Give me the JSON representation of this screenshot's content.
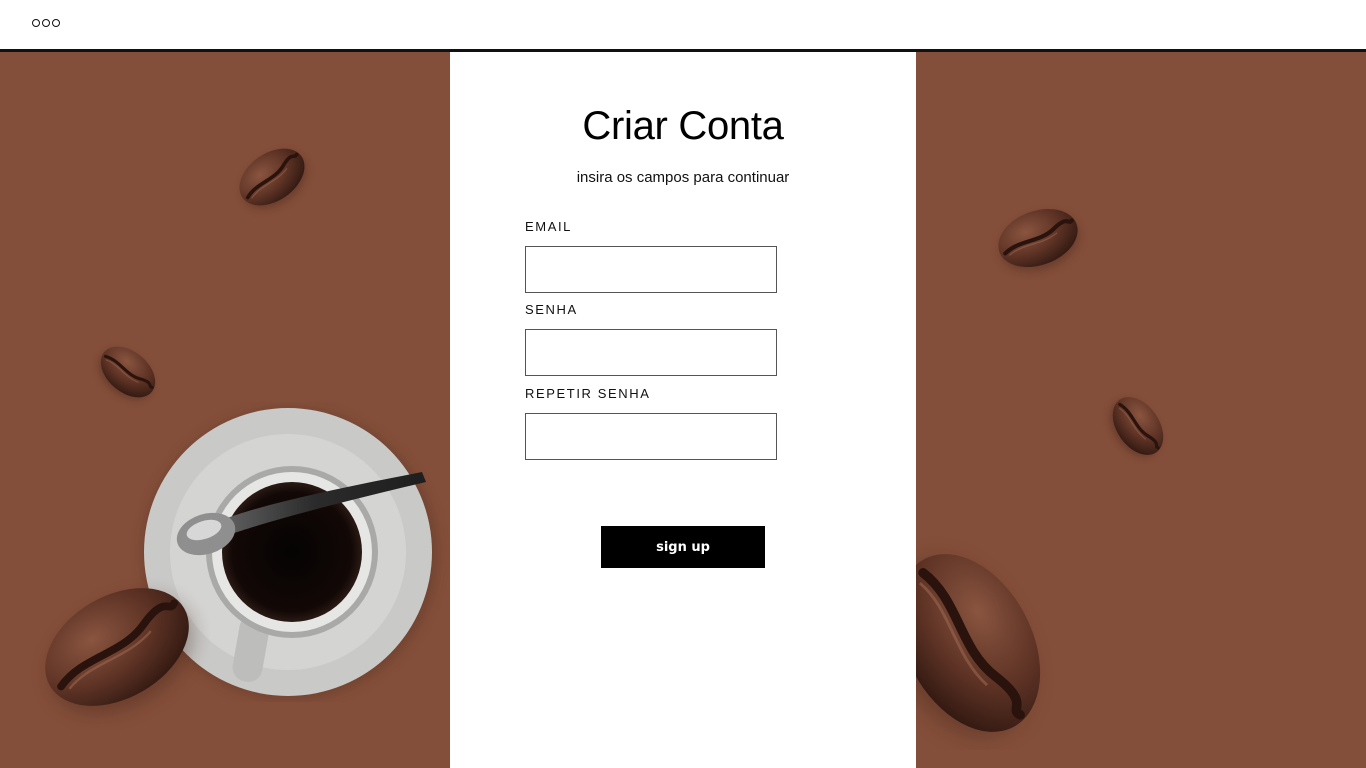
{
  "topbar": {
    "menu_icon": "more-dots-icon"
  },
  "form": {
    "title": "Criar Conta",
    "subtitle": "insira os campos para continuar",
    "email_label": "EMAIL",
    "email_value": "",
    "password_label": "SENHA",
    "password_value": "",
    "repeat_password_label": "REPETIR SENHA",
    "repeat_password_value": "",
    "submit_label": "sign up"
  },
  "colors": {
    "background_brown": "#844f3a",
    "card": "#ffffff",
    "button": "#000000",
    "button_text": "#ffffff"
  },
  "decor": {
    "left_panel": [
      "coffee-bean-icon",
      "coffee-bean-icon",
      "coffee-cup-icon",
      "spoon-icon",
      "coffee-bean-icon"
    ],
    "right_panel": [
      "coffee-bean-icon",
      "coffee-bean-icon",
      "coffee-bean-icon"
    ]
  }
}
